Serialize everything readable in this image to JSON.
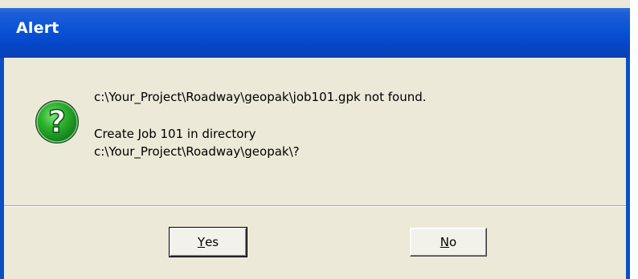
{
  "window": {
    "title": "Alert"
  },
  "message": {
    "line1": "c:\\Your_Project\\Roadway\\geopak\\job101.gpk not found.",
    "line2": "Create Job 101 in directory",
    "line3": "c:\\Your_Project\\Roadway\\geopak\\?"
  },
  "icon": {
    "name": "question-icon",
    "glyph": "?",
    "color": "#2aa52a"
  },
  "buttons": {
    "yes": {
      "accel": "Y",
      "rest": "es"
    },
    "no": {
      "accel": "N",
      "rest": "o"
    }
  }
}
